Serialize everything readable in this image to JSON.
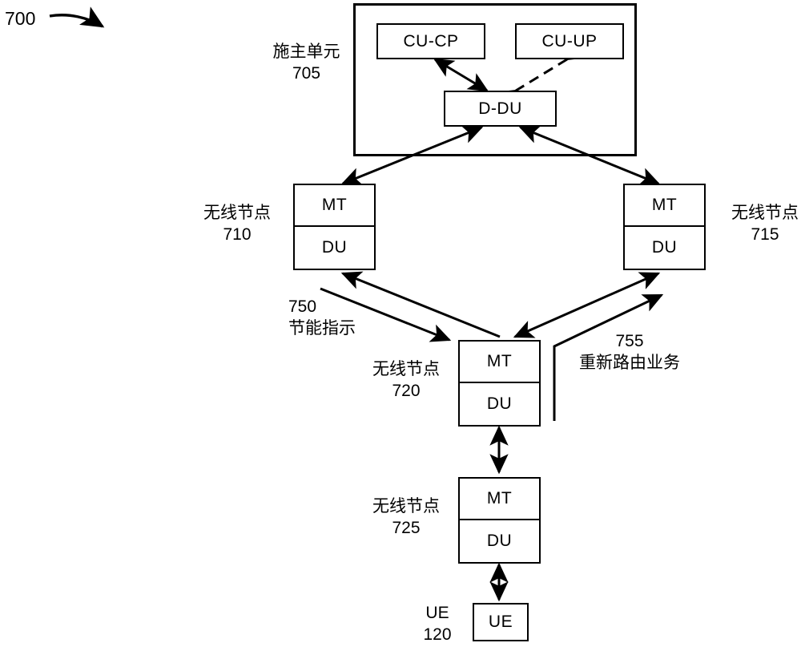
{
  "figure": {
    "ref_number": "700"
  },
  "host_unit": {
    "label_line1": "施主单元",
    "label_line2": "705",
    "cu_cp": "CU-CP",
    "cu_up": "CU-UP",
    "d_du": "D-DU"
  },
  "nodes": [
    {
      "id": "710",
      "label_line1": "无线节点",
      "label_line2": "710",
      "mt": "MT",
      "du": "DU"
    },
    {
      "id": "715",
      "label_line1": "无线节点",
      "label_line2": "715",
      "mt": "MT",
      "du": "DU"
    },
    {
      "id": "720",
      "label_line1": "无线节点",
      "label_line2": "720",
      "mt": "MT",
      "du": "DU"
    },
    {
      "id": "725",
      "label_line1": "无线节点",
      "label_line2": "725",
      "mt": "MT",
      "du": "DU"
    }
  ],
  "ue": {
    "label_line1": "UE",
    "label_line2": "120",
    "box_text": "UE"
  },
  "annotations": [
    {
      "id": "750",
      "ref": "750",
      "text": "节能指示"
    },
    {
      "id": "755",
      "ref": "755",
      "text": "重新路由业务"
    }
  ],
  "colors": {
    "stroke": "#000000",
    "background": "#ffffff"
  }
}
